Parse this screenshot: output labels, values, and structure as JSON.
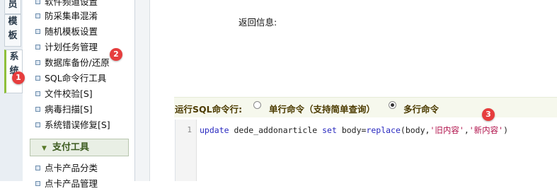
{
  "left_tabs": [
    {
      "label": "员"
    },
    {
      "label": "模板"
    },
    {
      "label": "系统"
    }
  ],
  "sidebar": {
    "items": [
      {
        "label": "软件频道设置"
      },
      {
        "label": "防采集串混淆"
      },
      {
        "label": "随机模板设置"
      },
      {
        "label": "计划任务管理"
      },
      {
        "label": "数据库备份/还原"
      },
      {
        "label": "SQL命令行工具"
      },
      {
        "label": "文件校验[S]"
      },
      {
        "label": "病毒扫描[S]"
      },
      {
        "label": "系统错误修复[S]"
      }
    ],
    "section_header": "支付工具",
    "section_items": [
      {
        "label": "点卡产品分类"
      },
      {
        "label": "点卡产品管理"
      }
    ]
  },
  "main": {
    "return_info_label": "返回信息:",
    "sql_row_label": "运行SQL命令行:",
    "option_single": "单行命令（支持简单查询）",
    "option_multi": "多行命令",
    "selected_option": "多行命令",
    "editor": {
      "line_number": "1",
      "tokens": {
        "kw_update": "update",
        "t1": " dede_addonarticle ",
        "kw_set": "set",
        "t2": " body=",
        "kw_replace": "replace",
        "t3": "(body,",
        "s1": "'旧内容'",
        "t4": ",",
        "s2": "'新内容'",
        "t5": ")"
      }
    }
  },
  "markers": [
    "1",
    "2",
    "3"
  ]
}
